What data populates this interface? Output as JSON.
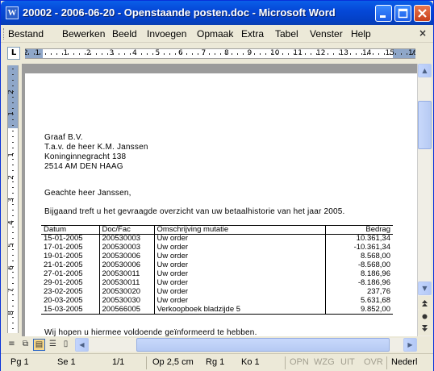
{
  "window": {
    "title": "20002 - 2006-06-20 - Openstaande posten.doc - Microsoft Word",
    "app_icon": "word-icon",
    "controls": [
      "minimize-icon",
      "maximize-icon",
      "close-icon"
    ]
  },
  "menu": {
    "items": [
      "Bestand",
      "Bewerken",
      "Beeld",
      "Invoegen",
      "Opmaak",
      "Extra",
      "Tabel",
      "Venster",
      "Help"
    ],
    "close_glyph": "×"
  },
  "ruler": {
    "tab_selector": "L",
    "numbers": [
      "2",
      "1",
      "1",
      "2",
      "3",
      "4",
      "5",
      "6",
      "7",
      "8",
      "9",
      "10",
      "11",
      "12",
      "13",
      "14",
      "15",
      "16"
    ],
    "vnumbers": [
      "2",
      "1",
      "1",
      "2",
      "3",
      "4",
      "5",
      "6",
      "7",
      "8"
    ]
  },
  "document": {
    "address": [
      "Graaf B.V.",
      "T.a.v. de heer K.M. Janssen",
      "Koninginnegracht 138",
      "2514 AM DEN HAAG"
    ],
    "salutation": "Geachte heer Janssen,",
    "intro": "Bijgaand treft u het gevraagde overzicht van uw betaalhistorie van het jaar 2005.",
    "table": {
      "headers": [
        "Datum",
        "Doc/Fac",
        "Omschrijving mutatie",
        "Bedrag"
      ],
      "rows": [
        [
          "15-01-2005",
          "200530003",
          "Uw order",
          "10.361,34"
        ],
        [
          "17-01-2005",
          "200530003",
          "Uw order",
          "-10.361,34"
        ],
        [
          "19-01-2005",
          "200530006",
          "Uw order",
          "8.568,00"
        ],
        [
          "21-01-2005",
          "200530006",
          "Uw order",
          "-8.568,00"
        ],
        [
          "27-01-2005",
          "200530011",
          "Uw order",
          "8.186,96"
        ],
        [
          "29-01-2005",
          "200530011",
          "Uw order",
          "-8.186,96"
        ],
        [
          "23-02-2005",
          "200530020",
          "Uw order",
          "237,76"
        ],
        [
          "20-03-2005",
          "200530030",
          "Uw order",
          "5.631,68"
        ],
        [
          "15-03-2005",
          "200566005",
          "Verkoopboek bladzijde 5",
          "9.852,00"
        ]
      ]
    },
    "closing": "Wij hopen u hiermee voldoende geïnformeerd te hebben."
  },
  "statusbar": {
    "page": "Pg  1",
    "section": "Se  1",
    "pages": "1/1",
    "at": "Op  2,5 cm",
    "line": "Rg  1",
    "column": "Ko  1",
    "modes": [
      "OPN",
      "WZG",
      "UIT",
      "OVR"
    ],
    "language": "Nederl"
  }
}
